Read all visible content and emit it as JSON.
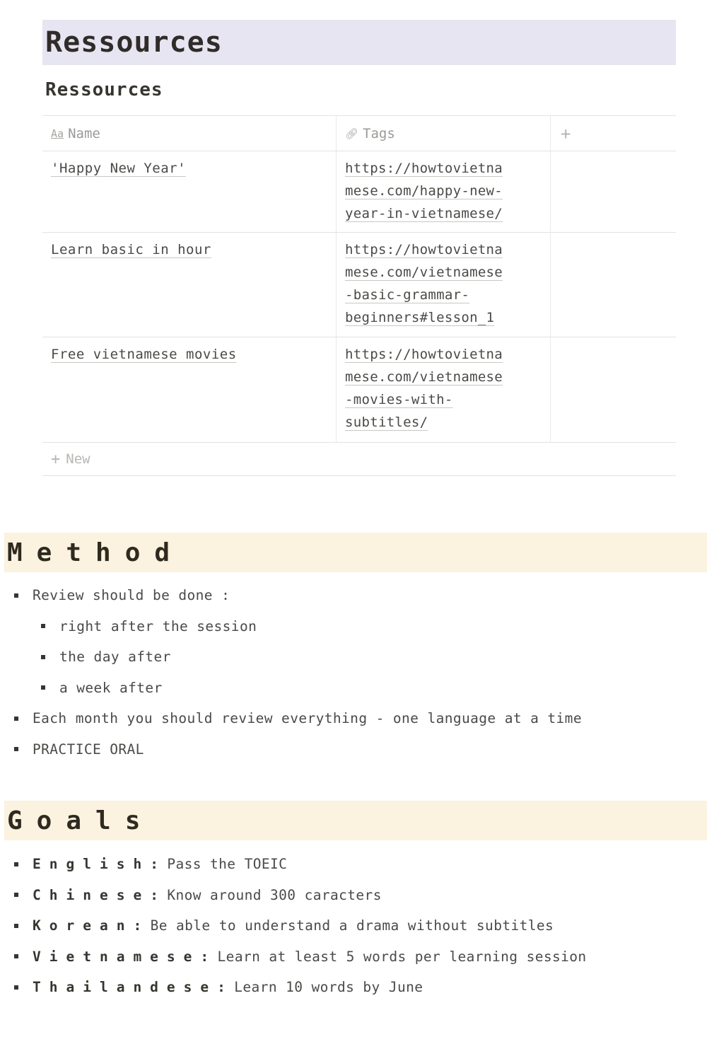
{
  "page": {
    "heading": "Ressources",
    "heading_bg": "#e8e5f2"
  },
  "database": {
    "title": "Ressources",
    "columns": [
      {
        "label": "Name",
        "icon": "title-property-icon"
      },
      {
        "label": "Tags",
        "icon": "url-link-icon"
      },
      {
        "label": "",
        "icon": "add-column-icon"
      }
    ],
    "rows": [
      {
        "name": "'Happy New Year'",
        "tags": [
          "https://howtovietna",
          "mese.com/happy-new-",
          "year-in-vietnamese/"
        ]
      },
      {
        "name": "Learn basic in hour",
        "tags": [
          "https://howtovietna",
          "mese.com/vietnamese",
          "-basic-grammar-",
          "beginners#lesson_1"
        ]
      },
      {
        "name": "Free vietnamese movies",
        "tags": [
          "https://howtovietna",
          "mese.com/vietnamese",
          "-movies-with-",
          "subtitles/"
        ]
      }
    ],
    "new_label": "New"
  },
  "method": {
    "heading": "Method",
    "heading_bg": "#fbf2df",
    "items": [
      {
        "text": "Review should be done :",
        "level": 0
      },
      {
        "text": "right after the session",
        "level": 1
      },
      {
        "text": "the day after",
        "level": 1
      },
      {
        "text": "a week after",
        "level": 1
      },
      {
        "text": "Each month you should review everything - one language at a time",
        "level": 0
      },
      {
        "text": "PRACTICE ORAL",
        "level": 0
      }
    ]
  },
  "goals": {
    "heading": "Goals",
    "heading_bg": "#fbf2df",
    "items": [
      {
        "language": "English",
        "goal": "Pass the TOEIC"
      },
      {
        "language": "Chinese",
        "goal": "Know around 300 caracters"
      },
      {
        "language": "Korean",
        "goal": "Be able to understand a drama without subtitles"
      },
      {
        "language": "Vietnamese",
        "goal": "Learn at least 5 words per learning session"
      },
      {
        "language": "Thailandese",
        "goal": "Learn 10 words by June"
      }
    ]
  }
}
